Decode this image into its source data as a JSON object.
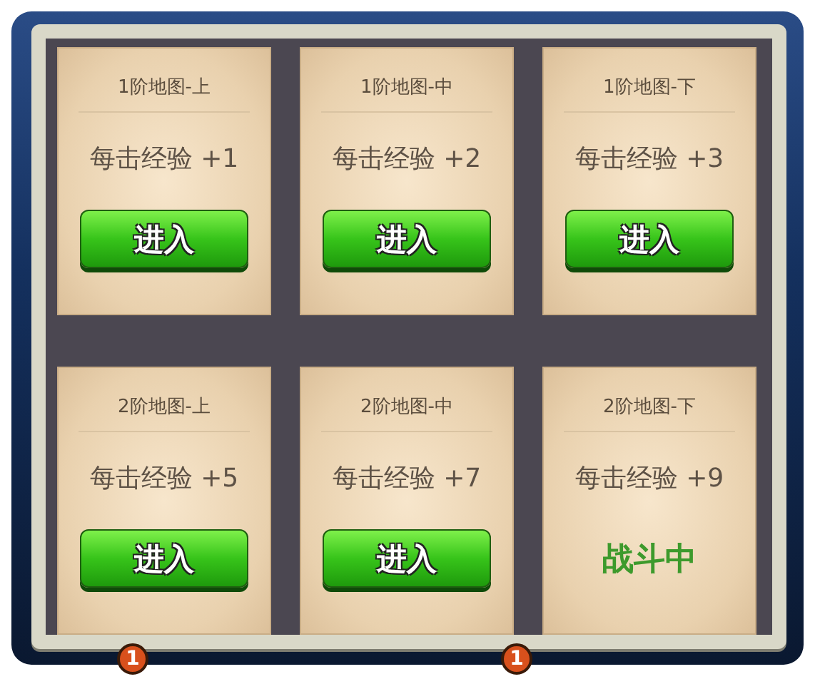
{
  "cards": [
    {
      "title": "1阶地图-上",
      "reward": "每击经验 +1",
      "kind": "button",
      "action": "进入"
    },
    {
      "title": "1阶地图-中",
      "reward": "每击经验 +2",
      "kind": "button",
      "action": "进入"
    },
    {
      "title": "1阶地图-下",
      "reward": "每击经验 +3",
      "kind": "button",
      "action": "进入"
    },
    {
      "title": "2阶地图-上",
      "reward": "每击经验 +5",
      "kind": "button",
      "action": "进入"
    },
    {
      "title": "2阶地图-中",
      "reward": "每击经验 +7",
      "kind": "button",
      "action": "进入"
    },
    {
      "title": "2阶地图-下",
      "reward": "每击经验 +9",
      "kind": "status",
      "action": "战斗中"
    }
  ],
  "badges": [
    "1",
    "1"
  ]
}
